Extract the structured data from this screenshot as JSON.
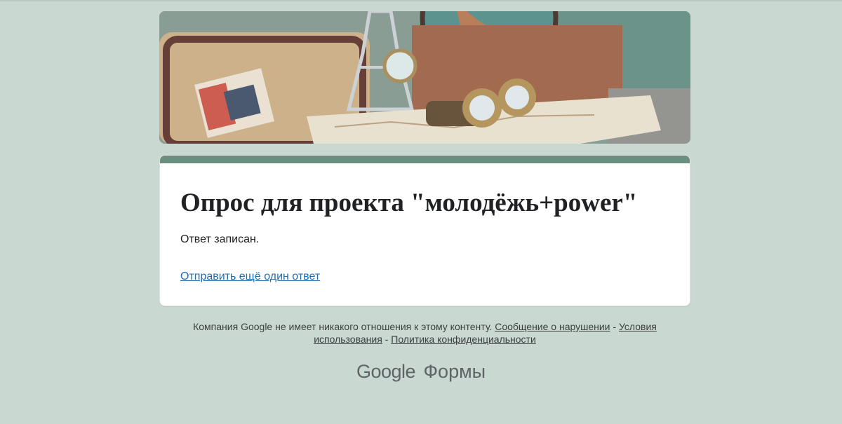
{
  "form": {
    "title": "Опрос для проекта \"молодёжь+power\"",
    "confirmation": "Ответ записан.",
    "resubmit_link": "Отправить ещё один ответ",
    "accent_color": "#6a8e7f"
  },
  "footer": {
    "disclaimer": "Компания Google не имеет никакого отношения к этому контенту.",
    "report_link": "Сообщение о нарушении",
    "sep1": " - ",
    "terms_link": "Условия использования",
    "sep2": " - ",
    "privacy_link": "Политика конфиденциальности"
  },
  "brand": {
    "google": "Google",
    "product": "Формы"
  },
  "colors": {
    "background": "#c9d8d1",
    "link": "#1f6db2"
  }
}
